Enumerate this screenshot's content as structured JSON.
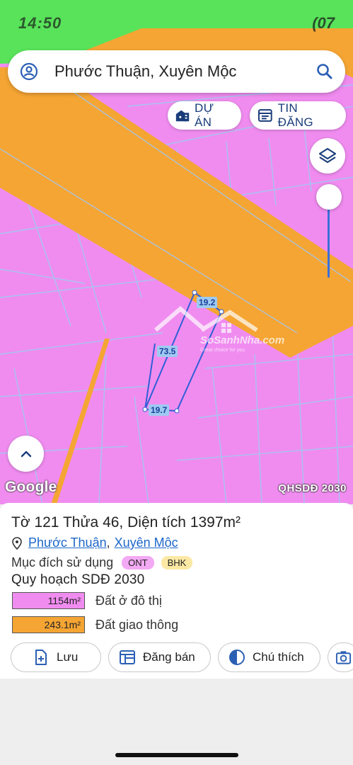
{
  "status_bar": {
    "time": "14:50",
    "right": "(07"
  },
  "search": {
    "text": "Phước Thuận, Xuyên Mộc"
  },
  "chips": {
    "project": "DỰ ÁN",
    "news": "TIN ĐĂNG"
  },
  "map": {
    "google_label": "Google",
    "map_layer_tag": "QHSDĐ 2030",
    "dimensions": {
      "top": "19.2",
      "left": "73.5",
      "bottom": "19.7"
    },
    "watermark": {
      "brand": "SoSanhNha.com",
      "slogan": "Great choice for you"
    },
    "colors": {
      "residential": "#f08cf0",
      "road": "#f5a533",
      "parcel_lines": "#a4c6f0",
      "top_green": "#58e35a"
    }
  },
  "parcel": {
    "sheet_label": "Tờ",
    "sheet_no": "121",
    "plot_label": "Thửa",
    "plot_no": "46",
    "area_label": "Diện tích",
    "area_value": "1397m²",
    "ward": "Phước Thuận",
    "district": "Xuyên Mộc",
    "purpose_label": "Mục đích sử dụng",
    "purpose_tags": [
      "ONT",
      "BHK"
    ],
    "plan_title": "Quy hoạch SDĐ 2030",
    "legend": [
      {
        "area": "1154m²",
        "label": "Đất ở đô thị",
        "color": "#f08cf0"
      },
      {
        "area": "243.1m²",
        "label": "Đất giao thông",
        "color": "#f5a533"
      }
    ]
  },
  "actions": {
    "save": "Lưu",
    "sell": "Đăng bán",
    "note": "Chú thích"
  }
}
